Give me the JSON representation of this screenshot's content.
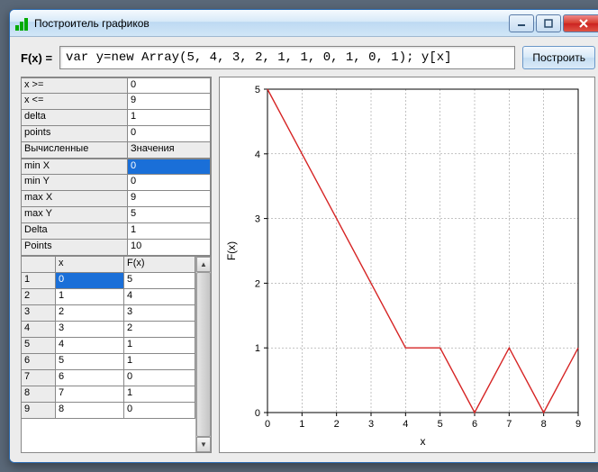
{
  "window": {
    "title": "Построитель графиков"
  },
  "formula": {
    "label": "F(x) =",
    "value": "var y=new Array(5, 4, 3, 2, 1, 1, 0, 1, 0, 1); y[x]"
  },
  "buttons": {
    "build": "Построить"
  },
  "params": {
    "items": [
      {
        "key": "x >=",
        "val": "0"
      },
      {
        "key": "x <=",
        "val": "9"
      },
      {
        "key": "delta",
        "val": "1"
      },
      {
        "key": "points",
        "val": "0"
      }
    ],
    "section2_head": {
      "key": "Вычисленные",
      "val": "Значения"
    },
    "computed": [
      {
        "key": "min X",
        "val": "0",
        "sel": true
      },
      {
        "key": "min Y",
        "val": "0"
      },
      {
        "key": "max X",
        "val": "9"
      },
      {
        "key": "max Y",
        "val": "5"
      },
      {
        "key": "Delta",
        "val": "1"
      },
      {
        "key": "Points",
        "val": "10"
      }
    ]
  },
  "data_table": {
    "headers": [
      "",
      "x",
      "F(x)"
    ],
    "rows": [
      {
        "n": "1",
        "x": "0",
        "fx": "5",
        "sel": true
      },
      {
        "n": "2",
        "x": "1",
        "fx": "4"
      },
      {
        "n": "3",
        "x": "2",
        "fx": "3"
      },
      {
        "n": "4",
        "x": "3",
        "fx": "2"
      },
      {
        "n": "5",
        "x": "4",
        "fx": "1"
      },
      {
        "n": "6",
        "x": "5",
        "fx": "1"
      },
      {
        "n": "7",
        "x": "6",
        "fx": "0"
      },
      {
        "n": "8",
        "x": "7",
        "fx": "1"
      },
      {
        "n": "9",
        "x": "8",
        "fx": "0"
      }
    ]
  },
  "chart_data": {
    "type": "line",
    "x": [
      0,
      1,
      2,
      3,
      4,
      5,
      6,
      7,
      8,
      9
    ],
    "y": [
      5,
      4,
      3,
      2,
      1,
      1,
      0,
      1,
      0,
      1
    ],
    "xlabel": "x",
    "ylabel": "F(x)",
    "xlim": [
      0,
      9
    ],
    "ylim": [
      0,
      5
    ],
    "xticks": [
      0,
      1,
      2,
      3,
      4,
      5,
      6,
      7,
      8,
      9
    ],
    "yticks": [
      0,
      1,
      2,
      3,
      4,
      5
    ],
    "color": "#d62424"
  }
}
